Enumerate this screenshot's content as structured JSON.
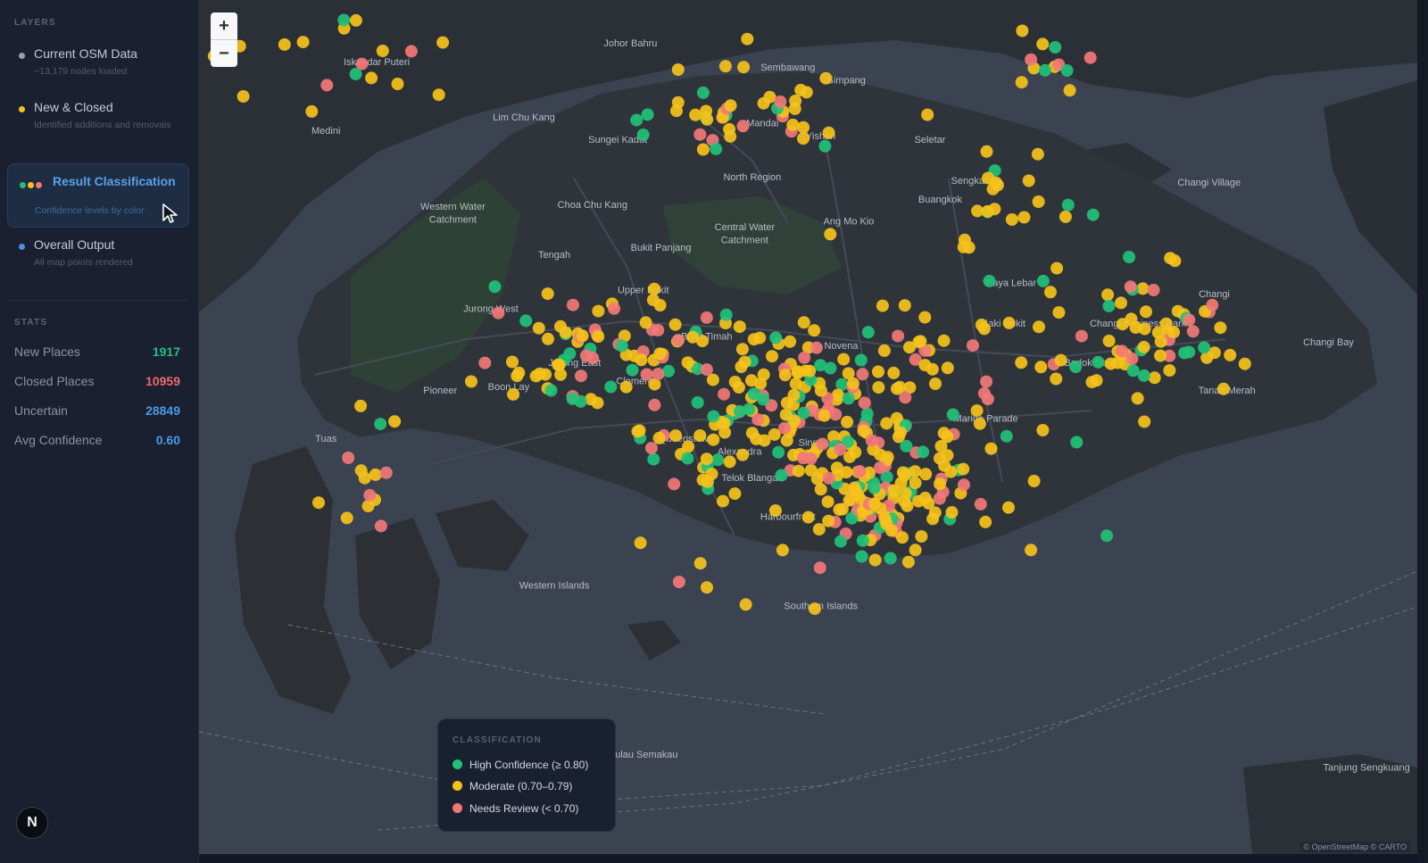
{
  "sidebar": {
    "layers_heading": "LAYERS",
    "layers": [
      {
        "title": "Current OSM Data",
        "subtitle": "~13,179 nodes loaded",
        "dot_color": "#9aa1ac"
      },
      {
        "title": "New & Closed",
        "subtitle": "Identified additions and removals",
        "dot_color": "#f5c21b"
      },
      {
        "title": "Result Classification",
        "subtitle": "Confidence levels by color",
        "dot_colors": [
          "#22c17a",
          "#f5c21b",
          "#f27878"
        ]
      },
      {
        "title": "Overall Output",
        "subtitle": "All map points rendered",
        "dot_color": "#4f8fe0"
      }
    ],
    "stats_heading": "STATS",
    "stats": [
      {
        "label": "New Places",
        "value": "1917",
        "color": "#27c07c"
      },
      {
        "label": "Closed Places",
        "value": "10959",
        "color": "#f06a6a"
      },
      {
        "label": "Uncertain",
        "value": "28849",
        "color": "#4a9ae8"
      },
      {
        "label": "Avg Confidence",
        "value": "0.60",
        "color": "#4a9ae8"
      }
    ],
    "logo_letter": "N"
  },
  "map": {
    "zoom_in": "+",
    "zoom_out": "−",
    "labels": [
      {
        "text": "Johor Bahru",
        "lng": 103.76,
        "lat": 1.465
      },
      {
        "text": "Iskandar Puteri",
        "lng": 103.66,
        "lat": 1.455
      },
      {
        "text": "Medini",
        "lng": 103.64,
        "lat": 1.418
      },
      {
        "text": "Lim Chu Kang",
        "lng": 103.718,
        "lat": 1.425
      },
      {
        "text": "Sungei Kadut",
        "lng": 103.755,
        "lat": 1.413
      },
      {
        "text": "Mandai",
        "lng": 103.812,
        "lat": 1.422
      },
      {
        "text": "Sembawang",
        "lng": 103.822,
        "lat": 1.452
      },
      {
        "text": "Simpang",
        "lng": 103.845,
        "lat": 1.445
      },
      {
        "text": "Yishun",
        "lng": 103.835,
        "lat": 1.415
      },
      {
        "text": "Seletar",
        "lng": 103.878,
        "lat": 1.413
      },
      {
        "text": "North Region",
        "lng": 103.808,
        "lat": 1.393
      },
      {
        "text": "Western Water",
        "lng": 103.69,
        "lat": 1.377
      },
      {
        "text": "Catchment",
        "lng": 103.69,
        "lat": 1.37
      },
      {
        "text": "Choa Chu Kang",
        "lng": 103.745,
        "lat": 1.378
      },
      {
        "text": "Central Water",
        "lng": 103.805,
        "lat": 1.366
      },
      {
        "text": "Catchment",
        "lng": 103.805,
        "lat": 1.359
      },
      {
        "text": "Ang Mo Kio",
        "lng": 103.846,
        "lat": 1.369
      },
      {
        "text": "Sengkang",
        "lng": 103.895,
        "lat": 1.391
      },
      {
        "text": "Buangkok",
        "lng": 103.882,
        "lat": 1.381
      },
      {
        "text": "Bukit Panjang",
        "lng": 103.772,
        "lat": 1.355
      },
      {
        "text": "Tengah",
        "lng": 103.73,
        "lat": 1.351
      },
      {
        "text": "Paya Lebar",
        "lng": 103.91,
        "lat": 1.336
      },
      {
        "text": "Changi Village",
        "lng": 103.988,
        "lat": 1.39
      },
      {
        "text": "Changi",
        "lng": 103.99,
        "lat": 1.33
      },
      {
        "text": "Upper Bukit",
        "lng": 103.765,
        "lat": 1.332
      },
      {
        "text": "Jurong West",
        "lng": 103.705,
        "lat": 1.322
      },
      {
        "text": "Bukit Timah",
        "lng": 103.79,
        "lat": 1.307
      },
      {
        "text": "Novena",
        "lng": 103.843,
        "lat": 1.302
      },
      {
        "text": "Kaki Bukit",
        "lng": 103.907,
        "lat": 1.314
      },
      {
        "text": "Changi Business Park",
        "lng": 103.96,
        "lat": 1.314
      },
      {
        "text": "Changi Bay",
        "lng": 104.035,
        "lat": 1.304
      },
      {
        "text": "Bedok South",
        "lng": 103.942,
        "lat": 1.293
      },
      {
        "text": "Tanah Merah",
        "lng": 103.995,
        "lat": 1.278
      },
      {
        "text": "Pioneer",
        "lng": 103.685,
        "lat": 1.278
      },
      {
        "text": "Boon Lay",
        "lng": 103.712,
        "lat": 1.28
      },
      {
        "text": "Jurong East",
        "lng": 103.738,
        "lat": 1.293
      },
      {
        "text": "Clementi",
        "lng": 103.762,
        "lat": 1.283
      },
      {
        "text": "Marine Parade",
        "lng": 103.9,
        "lat": 1.263
      },
      {
        "text": "Tuas",
        "lng": 103.64,
        "lat": 1.252
      },
      {
        "text": "Queenstown",
        "lng": 103.782,
        "lat": 1.252
      },
      {
        "text": "Alexandra",
        "lng": 103.803,
        "lat": 1.245
      },
      {
        "text": "Singapore",
        "lng": 103.835,
        "lat": 1.25
      },
      {
        "text": "Telok Blangah",
        "lng": 103.808,
        "lat": 1.231
      },
      {
        "text": "Harbourfront",
        "lng": 103.822,
        "lat": 1.21
      },
      {
        "text": "Western Islands",
        "lng": 103.73,
        "lat": 1.173
      },
      {
        "text": "Southern Islands",
        "lng": 103.835,
        "lat": 1.162
      },
      {
        "text": "Pulau Semakau",
        "lng": 103.765,
        "lat": 1.082
      },
      {
        "text": "Tanjung Sengkuang",
        "lng": 104.05,
        "lat": 1.075
      }
    ]
  },
  "legend": {
    "title": "CLASSIFICATION",
    "items": [
      {
        "label": "High Confidence (≥ 0.80)",
        "color": "#22c17a"
      },
      {
        "label": "Moderate (0.70–0.79)",
        "color": "#f5c21b"
      },
      {
        "label": "Needs Review (< 0.70)",
        "color": "#f27878"
      }
    ]
  },
  "attribution": "© OpenStreetMap © CARTO"
}
